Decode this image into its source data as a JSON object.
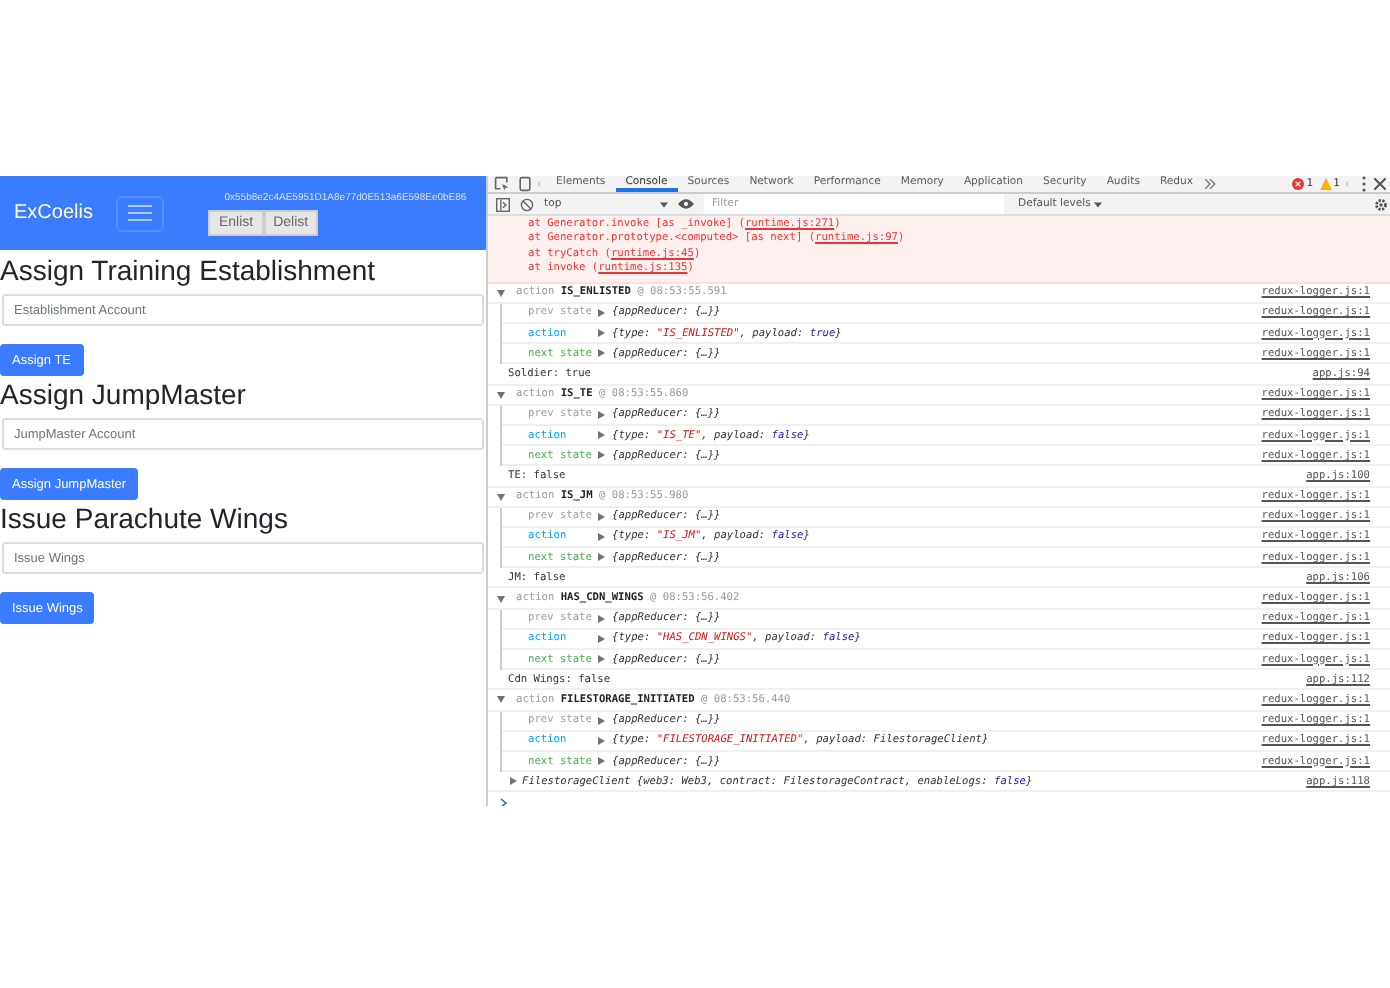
{
  "app": {
    "brand": "ExCoelis",
    "account": "0x55b8e2c4AE5951D1A8e77d0E513a6E598Ee0bE86",
    "nav_buttons": [
      {
        "label": "Enlist",
        "disabled": true
      },
      {
        "label": "Delist",
        "disabled": true
      }
    ],
    "sections": [
      {
        "heading": "Assign Training Establishment",
        "placeholder": "Establishment Account",
        "button": "Assign TE"
      },
      {
        "heading": "Assign JumpMaster",
        "placeholder": "JumpMaster Account",
        "button": "Assign JumpMaster"
      },
      {
        "heading": "Issue Parachute Wings",
        "placeholder": "Issue Wings",
        "button": "Issue Wings"
      }
    ]
  },
  "devtools": {
    "tabs": [
      {
        "label": "Elements",
        "selected": false
      },
      {
        "label": "Console",
        "selected": true
      },
      {
        "label": "Sources",
        "selected": false
      },
      {
        "label": "Network",
        "selected": false
      },
      {
        "label": "Performance",
        "selected": false
      },
      {
        "label": "Memory",
        "selected": false
      },
      {
        "label": "Application",
        "selected": false
      },
      {
        "label": "Security",
        "selected": false
      },
      {
        "label": "Audits",
        "selected": false
      },
      {
        "label": "Redux",
        "selected": false
      }
    ],
    "error_count": "1",
    "warning_count": "1",
    "context": "top",
    "filter_placeholder": "Filter",
    "levels": "Default levels",
    "error_lines": [
      {
        "text": "at Generator.invoke [as _invoke] (",
        "link": "runtime.js:271",
        "end": ")"
      },
      {
        "text": "at Generator.prototype.<computed> [as next] (",
        "link": "runtime.js:97",
        "end": ")"
      },
      {
        "text": "at tryCatch (",
        "link": "runtime.js:45",
        "end": ")"
      },
      {
        "text": "at invoke (",
        "link": "runtime.js:135",
        "end": ")"
      }
    ],
    "entries": [
      {
        "kind": "group",
        "expanded": true,
        "prefix": "action",
        "action": "IS_ENLISTED",
        "time": "@ 08:53:55.591",
        "source": "redux-logger.js:1",
        "rows": [
          {
            "kind": "prev",
            "label": "prev state",
            "parts": [
              {
                "text": "{appReducer: {…}}",
                "kind": "plain"
              }
            ],
            "source": "redux-logger.js:1"
          },
          {
            "kind": "action",
            "label": "action",
            "parts": [
              {
                "text": "{type: ",
                "kind": "plain"
              },
              {
                "text": "\"IS_ENLISTED\"",
                "kind": "string"
              },
              {
                "text": ", payload: ",
                "kind": "plain"
              },
              {
                "text": "true",
                "kind": "keyword"
              },
              {
                "text": "}",
                "kind": "plain"
              }
            ],
            "source": "redux-logger.js:1"
          },
          {
            "kind": "next",
            "label": "next state",
            "parts": [
              {
                "text": "{appReducer: {…}}",
                "kind": "plain"
              }
            ],
            "source": "redux-logger.js:1"
          }
        ]
      },
      {
        "kind": "log",
        "text": "Soldier: true",
        "source": "app.js:94"
      },
      {
        "kind": "group",
        "expanded": true,
        "prefix": "action",
        "action": "IS_TE",
        "time": "@ 08:53:55.860",
        "source": "redux-logger.js:1",
        "rows": [
          {
            "kind": "prev",
            "label": "prev state",
            "parts": [
              {
                "text": "{appReducer: {…}}",
                "kind": "plain"
              }
            ],
            "source": "redux-logger.js:1"
          },
          {
            "kind": "action",
            "label": "action",
            "parts": [
              {
                "text": "{type: ",
                "kind": "plain"
              },
              {
                "text": "\"IS_TE\"",
                "kind": "string"
              },
              {
                "text": ", payload: ",
                "kind": "plain"
              },
              {
                "text": "false",
                "kind": "keyword"
              },
              {
                "text": "}",
                "kind": "plain"
              }
            ],
            "source": "redux-logger.js:1"
          },
          {
            "kind": "next",
            "label": "next state",
            "parts": [
              {
                "text": "{appReducer: {…}}",
                "kind": "plain"
              }
            ],
            "source": "redux-logger.js:1"
          }
        ]
      },
      {
        "kind": "log",
        "text": "TE: false",
        "source": "app.js:100"
      },
      {
        "kind": "group",
        "expanded": true,
        "prefix": "action",
        "action": "IS_JM",
        "time": "@ 08:53:55.980",
        "source": "redux-logger.js:1",
        "rows": [
          {
            "kind": "prev",
            "label": "prev state",
            "parts": [
              {
                "text": "{appReducer: {…}}",
                "kind": "plain"
              }
            ],
            "source": "redux-logger.js:1"
          },
          {
            "kind": "action",
            "label": "action",
            "parts": [
              {
                "text": "{type: ",
                "kind": "plain"
              },
              {
                "text": "\"IS_JM\"",
                "kind": "string"
              },
              {
                "text": ", payload: ",
                "kind": "plain"
              },
              {
                "text": "false",
                "kind": "keyword"
              },
              {
                "text": "}",
                "kind": "plain"
              }
            ],
            "source": "redux-logger.js:1"
          },
          {
            "kind": "next",
            "label": "next state",
            "parts": [
              {
                "text": "{appReducer: {…}}",
                "kind": "plain"
              }
            ],
            "source": "redux-logger.js:1"
          }
        ]
      },
      {
        "kind": "log",
        "text": "JM: false",
        "source": "app.js:106"
      },
      {
        "kind": "group",
        "expanded": true,
        "prefix": "action",
        "action": "HAS_CDN_WINGS",
        "time": "@ 08:53:56.402",
        "source": "redux-logger.js:1",
        "rows": [
          {
            "kind": "prev",
            "label": "prev state",
            "parts": [
              {
                "text": "{appReducer: {…}}",
                "kind": "plain"
              }
            ],
            "source": "redux-logger.js:1"
          },
          {
            "kind": "action",
            "label": "action",
            "parts": [
              {
                "text": "{type: ",
                "kind": "plain"
              },
              {
                "text": "\"HAS_CDN_WINGS\"",
                "kind": "string"
              },
              {
                "text": ", payload: ",
                "kind": "plain"
              },
              {
                "text": "false",
                "kind": "keyword"
              },
              {
                "text": "}",
                "kind": "plain"
              }
            ],
            "source": "redux-logger.js:1"
          },
          {
            "kind": "next",
            "label": "next state",
            "parts": [
              {
                "text": "{appReducer: {…}}",
                "kind": "plain"
              }
            ],
            "source": "redux-logger.js:1"
          }
        ]
      },
      {
        "kind": "log",
        "text": "Cdn Wings: false",
        "source": "app.js:112"
      },
      {
        "kind": "group",
        "expanded": true,
        "prefix": "action",
        "action": "FILESTORAGE_INITIATED",
        "time": "@ 08:53:56.440",
        "source": "redux-logger.js:1",
        "rows": [
          {
            "kind": "prev",
            "label": "prev state",
            "parts": [
              {
                "text": "{appReducer: {…}}",
                "kind": "plain"
              }
            ],
            "source": "redux-logger.js:1"
          },
          {
            "kind": "action",
            "label": "action",
            "parts": [
              {
                "text": "{type: ",
                "kind": "plain"
              },
              {
                "text": "\"FILESTORAGE_INITIATED\"",
                "kind": "string"
              },
              {
                "text": ", payload: FilestorageClient}",
                "kind": "plain"
              }
            ],
            "source": "redux-logger.js:1"
          },
          {
            "kind": "next",
            "label": "next state",
            "parts": [
              {
                "text": "{appReducer: {…}}",
                "kind": "plain"
              }
            ],
            "source": "redux-logger.js:1"
          }
        ]
      },
      {
        "kind": "object",
        "expanded": false,
        "parts": [
          {
            "text": "FilestorageClient {web3: Web3, contract: FilestorageContract, enableLogs: ",
            "kind": "plain"
          },
          {
            "text": "false",
            "kind": "keyword"
          },
          {
            "text": "}",
            "kind": "plain"
          }
        ],
        "source": "app.js:118"
      },
      {
        "kind": "prompt"
      }
    ]
  }
}
